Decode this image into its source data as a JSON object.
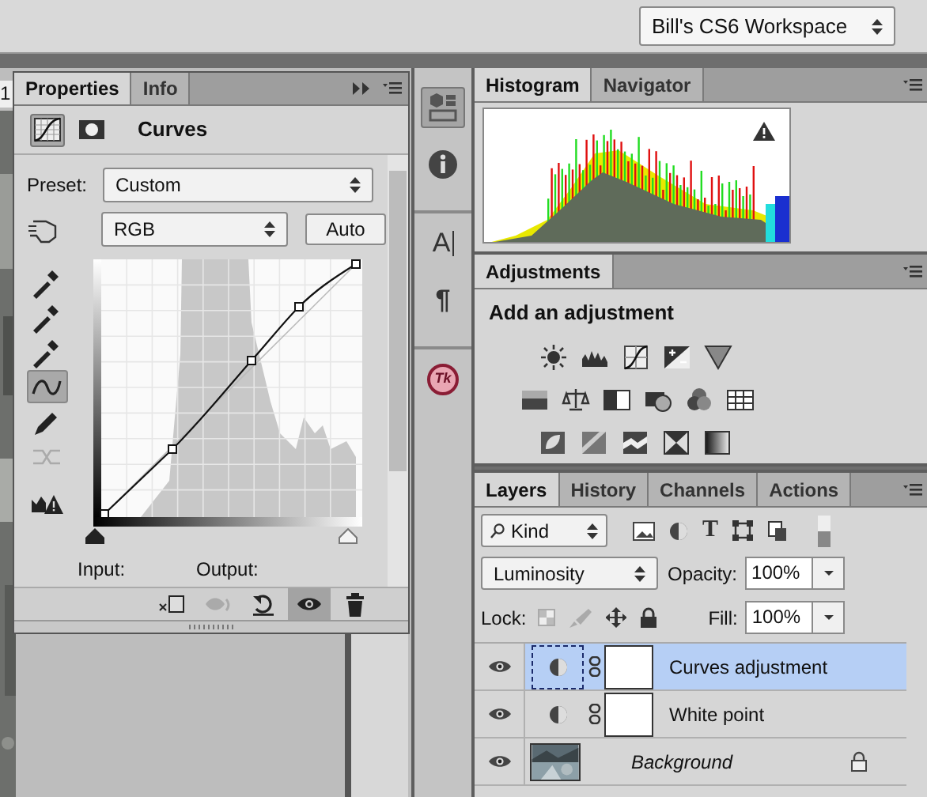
{
  "workspace_switcher": {
    "value": "Bill's CS6 Workspace"
  },
  "document_tab": {
    "label": "1"
  },
  "properties_panel": {
    "tabs": [
      {
        "label": "Properties",
        "selected": true
      },
      {
        "label": "Info",
        "selected": false
      }
    ],
    "mode_buttons": [
      {
        "kind": "adjustment",
        "selected": true
      },
      {
        "kind": "mask",
        "selected": false
      }
    ],
    "title": "Curves",
    "preset_label": "Preset:",
    "preset": "Custom",
    "channel": "RGB",
    "auto_button": "Auto",
    "tools": [
      {
        "kind": "eyedropper",
        "selected": false,
        "disabled": false
      },
      {
        "kind": "eyedropper",
        "selected": false,
        "disabled": false
      },
      {
        "kind": "eyedropper",
        "selected": false,
        "disabled": false
      },
      {
        "kind": "curve",
        "selected": true,
        "disabled": false
      },
      {
        "kind": "pencil",
        "selected": false,
        "disabled": false
      },
      {
        "kind": "smooth",
        "selected": false,
        "disabled": true
      },
      {
        "kind": "clipping",
        "selected": false,
        "disabled": false
      }
    ],
    "input_label": "Input:",
    "output_label": "Output:",
    "footer_buttons": [
      {
        "kind": "clip",
        "selected": false,
        "disabled": false
      },
      {
        "kind": "previous",
        "selected": false,
        "disabled": true
      },
      {
        "kind": "reset",
        "selected": false,
        "disabled": false
      },
      {
        "kind": "visibility",
        "selected": true,
        "disabled": false
      },
      {
        "kind": "delete",
        "selected": false,
        "disabled": false
      }
    ]
  },
  "dock": {
    "items": [
      {
        "kind": "model",
        "selected": true
      },
      {
        "kind": "info",
        "selected": false
      },
      {
        "kind": "character",
        "glyph": "A",
        "selected": false
      },
      {
        "kind": "paragraph",
        "glyph": "¶",
        "selected": false
      },
      {
        "kind": "tool_presets",
        "glyph": "Tk",
        "selected": false
      }
    ]
  },
  "histogram_panel": {
    "tabs": [
      {
        "label": "Histogram",
        "selected": true
      },
      {
        "label": "Navigator",
        "selected": false
      }
    ]
  },
  "adjustments_panel": {
    "tabs": [
      {
        "label": "Adjustments",
        "selected": true
      }
    ],
    "heading": "Add an adjustment"
  },
  "layers_panel": {
    "tabs": [
      {
        "label": "Layers",
        "selected": true
      },
      {
        "label": "History",
        "selected": false
      },
      {
        "label": "Channels",
        "selected": false
      },
      {
        "label": "Actions",
        "selected": false
      }
    ],
    "filter": "Kind",
    "type_filter_glyph": "T",
    "blend_mode": "Luminosity",
    "opacity_label": "Opacity:",
    "opacity": "100%",
    "lock_label": "Lock:",
    "fill_label": "Fill:",
    "fill": "100%",
    "layers": [
      {
        "name": "Curves adjustment",
        "kind": "adjustment",
        "selected": true,
        "visible": true
      },
      {
        "name": "White point",
        "kind": "adjustment",
        "selected": false,
        "visible": true
      },
      {
        "name": "Background",
        "kind": "background",
        "selected": false,
        "visible": true
      }
    ]
  }
}
